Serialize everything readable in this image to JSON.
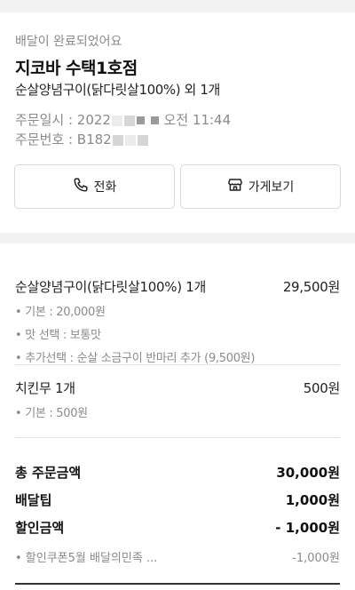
{
  "header": {
    "status": "배달이 완료되었어요",
    "store_name": "지코바 수택1호점",
    "summary": "순살양념구이(닭다릿살100%) 외 1개",
    "order_date_label": "주문일시 : 2022",
    "order_time": "오전 11:44",
    "order_number_label": "주문번호 : B182"
  },
  "actions": {
    "call_label": "전화",
    "store_label": "가게보기"
  },
  "items": [
    {
      "name": "순살양념구이(닭다릿살100%) 1개",
      "price": "29,500원",
      "options": [
        "• 기본 : 20,000원",
        "• 맛 선택 : 보통맛",
        "• 추가선택 : 순살 소금구이 반마리 추가 (9,500원)"
      ]
    },
    {
      "name": "치킨무 1개",
      "price": "500원",
      "options": [
        "• 기본 : 500원"
      ]
    }
  ],
  "totals": {
    "order_total_label": "총 주문금액",
    "order_total_value": "30,000원",
    "delivery_tip_label": "배달팁",
    "delivery_tip_value": "1,000원",
    "discount_label": "할인금액",
    "discount_value": "- 1,000원",
    "discount_detail_label": "• 할인쿠폰5월 배달의민족 ...",
    "discount_detail_value": "-1,000원"
  },
  "icons": {
    "call": "phone-icon",
    "store": "store-icon"
  }
}
